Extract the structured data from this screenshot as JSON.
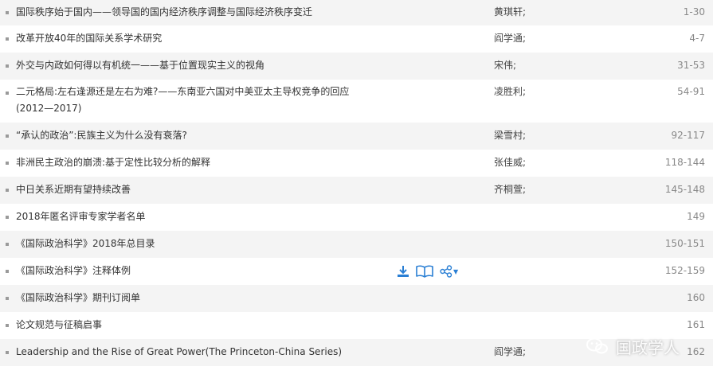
{
  "articles": [
    {
      "title": "国际秩序始于国内——领导国的国内经济秩序调整与国际经济秩序变迁",
      "author": "黄琪轩;",
      "pages": "1-30"
    },
    {
      "title": "改革开放40年的国际关系学术研究",
      "author": "阎学通;",
      "pages": "4-7"
    },
    {
      "title": "外交与内政如何得以有机统一——基于位置现实主义的视角",
      "author": "宋伟;",
      "pages": "31-53"
    },
    {
      "title": "二元格局:左右逢源还是左右为难?——东南亚六国对中美亚太主导权竞争的回应",
      "title2": "(2012—2017)",
      "author": "凌胜利;",
      "pages": "54-91"
    },
    {
      "title": "“承认的政治”:民族主义为什么没有衰落?",
      "author": "梁雪村;",
      "pages": "92-117"
    },
    {
      "title": "非洲民主政治的崩溃:基于定性比较分析的解释",
      "author": "张佳威;",
      "pages": "118-144"
    },
    {
      "title": "中日关系近期有望持续改善",
      "author": "齐桐萱;",
      "pages": "145-148"
    },
    {
      "title": "2018年匿名评审专家学者名单",
      "author": "",
      "pages": "149"
    },
    {
      "title": "《国际政治科学》2018年总目录",
      "author": "",
      "pages": "150-151"
    },
    {
      "title": "《国际政治科学》注释体例",
      "author": "",
      "pages": "152-159"
    },
    {
      "title": "《国际政治科学》期刊订阅单",
      "author": "",
      "pages": "160"
    },
    {
      "title": "论文规范与征稿启事",
      "author": "",
      "pages": "161"
    },
    {
      "title": "Leadership and the Rise of Great Power(The Princeton-China Series)",
      "author": "阎学通;",
      "pages": "162"
    }
  ],
  "action_icons": [
    "download-icon",
    "read-book-icon",
    "share-icon"
  ],
  "watermark": {
    "text": "国政学人",
    "logo_icon": "wechat-icon"
  },
  "colors": {
    "accent": "#2a7fd4",
    "row_alt_bg": "#f4f4f4",
    "text": "#333333",
    "pages_text": "#888888"
  }
}
